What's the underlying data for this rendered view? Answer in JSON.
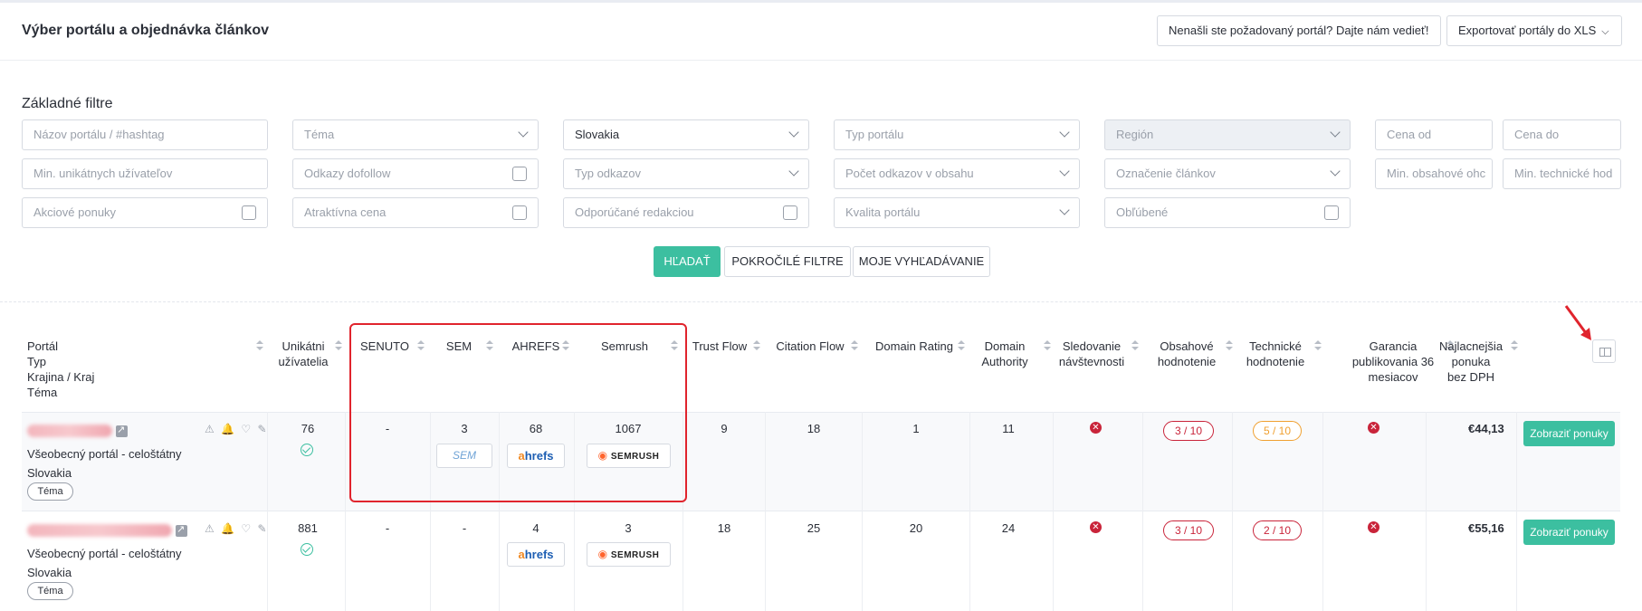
{
  "header": {
    "title": "Výber portálu a objednávka článkov",
    "missing_portal_btn": "Nenašli ste požadovaný portál? Dajte nám vedieť!",
    "export_btn": "Exportovať portály do XLS"
  },
  "filters": {
    "title": "Základné filtre",
    "row1": {
      "portal_name": "Názov portálu / #hashtag",
      "topic": "Téma",
      "country": "Slovakia",
      "portal_type": "Typ portálu",
      "region": "Región",
      "price_from": "Cena od",
      "price_to": "Cena do"
    },
    "row2": {
      "min_users": "Min. unikátnych užívateľov",
      "dofollow": "Odkazy dofollow",
      "link_type": "Typ odkazov",
      "link_count": "Počet odkazov v obsahu",
      "article_marking": "Označenie článkov",
      "min_content": "Min. obsahové ohc",
      "min_tech": "Min. technické hod"
    },
    "row3": {
      "special_offers": "Akciové ponuky",
      "attractive_price": "Atraktívna cena",
      "recommended": "Odporúčané redakciou",
      "quality": "Kvalita portálu",
      "favorites": "Obľúbené"
    },
    "search_btn": "HĽADAŤ",
    "advanced_btn": "POKROČILÉ FILTRE",
    "saved_btn": "MOJE VYHĽADÁVANIE"
  },
  "table": {
    "headers": {
      "portal": [
        "Portál",
        "Typ",
        "Krajina / Kraj",
        "Téma"
      ],
      "users": [
        "Unikátni",
        "užívatelia"
      ],
      "senuto": "SENUTO",
      "sem": "SEM",
      "ahrefs": "AHREFS",
      "semrush": "Semrush",
      "trust_flow": "Trust Flow",
      "citation_flow": "Citation Flow",
      "domain_rating": "Domain Rating",
      "domain_authority": [
        "Domain",
        "Authority"
      ],
      "traffic": [
        "Sledovanie",
        "návštevnosti"
      ],
      "content_rating": [
        "Obsahové",
        "hodnotenie"
      ],
      "tech_rating": [
        "Technické",
        "hodnotenie"
      ],
      "guarantee": [
        "Garancia",
        "publikovania 36",
        "mesiacov"
      ],
      "best_offer": [
        "Najlacnejšia",
        "ponuka",
        "bez DPH"
      ]
    },
    "logos": {
      "sem": "SEM",
      "ahrefs_a": "a",
      "ahrefs_rest": "hrefs",
      "semrush": "SEMRUSH"
    },
    "rows": [
      {
        "type": "Všeobecný portál - celoštátny",
        "country": "Slovakia",
        "tag": "Téma",
        "users": "76",
        "senuto": "-",
        "sem": "3",
        "ahrefs": "68",
        "semrush": "1067",
        "trust_flow": "9",
        "citation_flow": "18",
        "domain_rating": "1",
        "domain_authority": "11",
        "content_rating": "3 / 10",
        "tech_rating": "5 / 10",
        "price": "€44,13",
        "offer_btn": "Zobraziť ponuky"
      },
      {
        "type": "Všeobecný portál - celoštátny",
        "country": "Slovakia",
        "tag": "Téma",
        "users": "881",
        "senuto": "-",
        "sem": "-",
        "ahrefs": "4",
        "semrush": "3",
        "trust_flow": "18",
        "citation_flow": "25",
        "domain_rating": "20",
        "domain_authority": "24",
        "content_rating": "3 / 10",
        "tech_rating": "2 / 10",
        "price": "€55,16",
        "offer_btn": "Zobraziť ponuky"
      }
    ]
  },
  "icons": {
    "x_mark": "✕",
    "row_actions": "⚠ 🔔 ♡ ✎"
  }
}
